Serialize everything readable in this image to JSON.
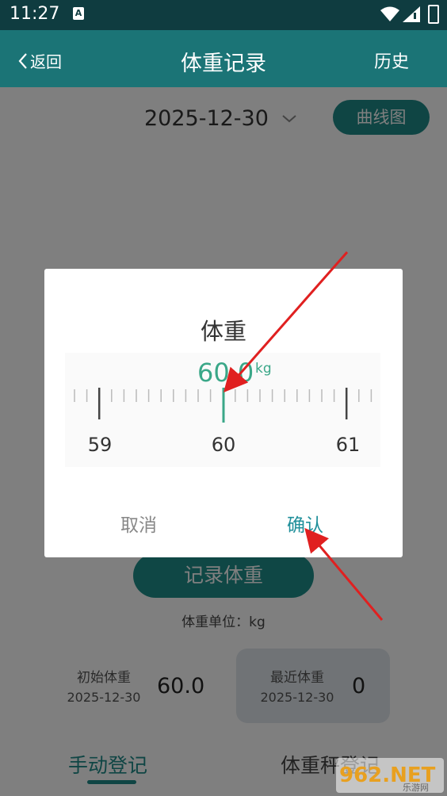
{
  "status_bar": {
    "time": "11:27",
    "notification_letter": "A"
  },
  "header": {
    "back_label": "返回",
    "title": "体重记录",
    "history_label": "历史"
  },
  "main": {
    "date": "2025-12-30",
    "curve_button": "曲线图",
    "record_button": "记录体重",
    "unit_text": "体重单位：kg",
    "initial_card": {
      "label": "初始体重",
      "date": "2025-12-30",
      "value": "60.0"
    },
    "recent_card": {
      "label": "最近体重",
      "date": "2025-12-30",
      "value": "0"
    },
    "tabs": [
      {
        "label": "手动登记",
        "active": true
      },
      {
        "label": "体重秤登记",
        "active": false
      }
    ]
  },
  "dialog": {
    "title": "体重",
    "value": "60.0",
    "unit": "kg",
    "tick_labels": [
      "59",
      "60",
      "61"
    ],
    "cancel_label": "取消",
    "confirm_label": "确认"
  },
  "colors": {
    "header": "#1b7476",
    "status_bar": "#0f3c40",
    "accent": "#1f8a88",
    "ruler_value": "#3aa788",
    "arrow": "#e02020"
  },
  "watermark": {
    "text": "962.NET",
    "subtext": "乐游网"
  }
}
